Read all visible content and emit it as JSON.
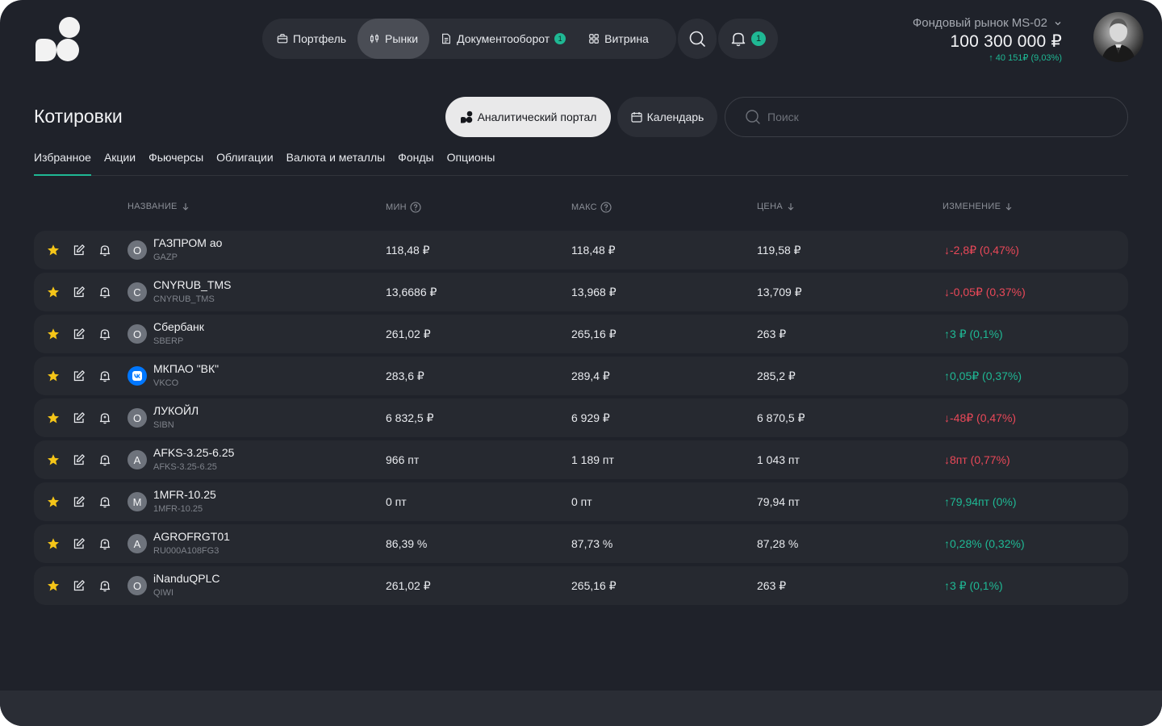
{
  "nav": {
    "items": [
      {
        "label": "Портфель",
        "icon": "briefcase-icon"
      },
      {
        "label": "Рынки",
        "icon": "candles-icon"
      },
      {
        "label": "Документооборот",
        "icon": "document-icon",
        "badge": "1"
      },
      {
        "label": "Витрина",
        "icon": "grid-icon"
      }
    ],
    "notifications_badge": "1"
  },
  "account": {
    "name": "Фондовый рынок MS-02",
    "balance": "100 300 000 ₽",
    "change": "40 151₽ (9,03%)"
  },
  "page": {
    "title": "Котировки",
    "analytic_label": "Аналитический портал",
    "calendar_label": "Календарь",
    "search_placeholder": "Поиск"
  },
  "tabs": [
    "Избранное",
    "Акции",
    "Фьючерсы",
    "Облигации",
    "Валюта и металлы",
    "Фонды",
    "Опционы"
  ],
  "columns": {
    "name": "НАЗВАНИЕ",
    "min": "МИН",
    "max": "МАКС",
    "price": "ЦЕНА",
    "change": "ИЗМЕНЕНИЕ"
  },
  "rows": [
    {
      "letter": "О",
      "name": "ГАЗПРОМ ао",
      "ticker": "GAZP",
      "min": "118,48 ₽",
      "max": "118,48 ₽",
      "price": "119,58 ₽",
      "change": "-2,8₽ (0,47%)",
      "dir": "down"
    },
    {
      "letter": "C",
      "name": "CNYRUB_TMS",
      "ticker": "CNYRUB_TMS",
      "min": "13,6686 ₽",
      "max": "13,968 ₽",
      "price": "13,709 ₽",
      "change": "-0,05₽ (0,37%)",
      "dir": "down"
    },
    {
      "letter": "О",
      "name": "Сбербанк",
      "ticker": "SBERP",
      "min": "261,02 ₽",
      "max": "265,16 ₽",
      "price": "263 ₽",
      "change": "3 ₽ (0,1%)",
      "dir": "up"
    },
    {
      "letter": "",
      "vk": true,
      "name": "МКПАО \"ВК\"",
      "ticker": "VKCO",
      "min": "283,6 ₽",
      "max": "289,4 ₽",
      "price": "285,2 ₽",
      "change": "0,05₽ (0,37%)",
      "dir": "up"
    },
    {
      "letter": "О",
      "name": "ЛУКОЙЛ",
      "ticker": "SIBN",
      "min": "6 832,5 ₽",
      "max": "6 929 ₽",
      "price": "6 870,5 ₽",
      "change": "-48₽ (0,47%)",
      "dir": "down"
    },
    {
      "letter": "A",
      "name": "AFKS-3.25-6.25",
      "ticker": "AFKS-3.25-6.25",
      "min": "966 пт",
      "max": "1 189 пт",
      "price": "1 043 пт",
      "change": "8пт (0,77%)",
      "dir": "down"
    },
    {
      "letter": "M",
      "name": "1MFR-10.25",
      "ticker": "1MFR-10.25",
      "min": "0 пт",
      "max": "0 пт",
      "price": "79,94 пт",
      "change": "79,94пт (0%)",
      "dir": "up"
    },
    {
      "letter": "A",
      "name": "AGROFRGT01",
      "ticker": "RU000A108FG3",
      "min": "86,39 %",
      "max": "87,73 %",
      "price": "87,28 %",
      "change": "0,28% (0,32%)",
      "dir": "up"
    },
    {
      "letter": "О",
      "name": "iNanduQPLC",
      "ticker": "QIWI",
      "min": "261,02 ₽",
      "max": "265,16 ₽",
      "price": "263 ₽",
      "change": "3 ₽ (0,1%)",
      "dir": "up"
    }
  ],
  "colors": {
    "accent": "#1fb894",
    "negative": "#e94858",
    "background": "#1f222a",
    "star": "#f5c518"
  }
}
